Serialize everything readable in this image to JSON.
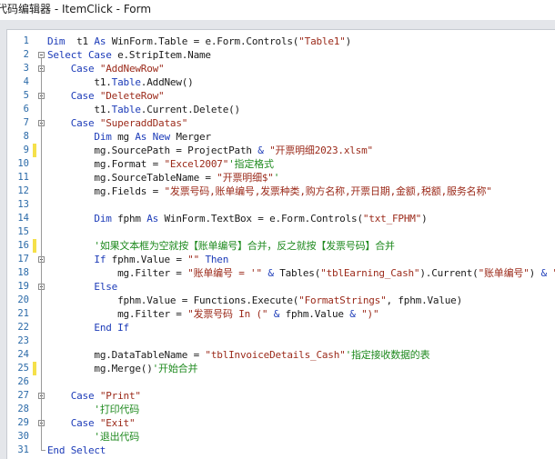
{
  "window": {
    "title": "代码编辑器 - ItemClick - Form"
  },
  "colors": {
    "keyword": "#1c3bb8",
    "string": "#9b2a1a",
    "comment": "#1f8a1f",
    "line_number": "#2b6aa8",
    "change_mark": "#f5e04a"
  },
  "lines": [
    {
      "n": "1",
      "indent": "",
      "parts": [
        [
          "kw",
          "Dim"
        ],
        [
          "",
          "  t1 "
        ],
        [
          "kw",
          "As"
        ],
        [
          "",
          " WinForm.Table = e.Form.Controls("
        ],
        [
          "st",
          "\"Table1\""
        ],
        [
          "",
          ")"
        ]
      ]
    },
    {
      "n": "2",
      "indent": "",
      "parts": [
        [
          "kw",
          "Select Case"
        ],
        [
          "",
          " e.StripItem.Name"
        ]
      ]
    },
    {
      "n": "3",
      "indent": "    ",
      "parts": [
        [
          "kw",
          "Case"
        ],
        [
          " ",
          ""
        ],
        [
          "st",
          " \"AddNewRow\""
        ]
      ]
    },
    {
      "n": "4",
      "indent": "        ",
      "parts": [
        [
          "",
          "t1."
        ],
        [
          "kw",
          "Table"
        ],
        [
          "",
          ".AddNew()"
        ]
      ]
    },
    {
      "n": "5",
      "indent": "    ",
      "parts": [
        [
          "kw",
          "Case"
        ],
        [
          "st",
          " \"DeleteRow\""
        ]
      ]
    },
    {
      "n": "6",
      "indent": "        ",
      "parts": [
        [
          "",
          "t1."
        ],
        [
          "kw",
          "Table"
        ],
        [
          "",
          ".Current.Delete()"
        ]
      ]
    },
    {
      "n": "7",
      "indent": "    ",
      "parts": [
        [
          "kw",
          "Case"
        ],
        [
          "st",
          " \"SuperaddDatas\""
        ]
      ]
    },
    {
      "n": "8",
      "indent": "        ",
      "parts": [
        [
          "kw",
          "Dim"
        ],
        [
          "",
          " mg "
        ],
        [
          "kw",
          "As New"
        ],
        [
          "",
          " Merger"
        ]
      ]
    },
    {
      "n": "9",
      "indent": "        ",
      "parts": [
        [
          "",
          "mg.SourcePath = ProjectPath "
        ],
        [
          "kw",
          "&"
        ],
        [
          "st",
          " \"开票明细2023.xlsm\""
        ]
      ]
    },
    {
      "n": "10",
      "indent": "        ",
      "parts": [
        [
          "",
          "mg.Format = "
        ],
        [
          "st",
          "\"Excel2007\""
        ],
        [
          "cm",
          "'指定格式"
        ]
      ]
    },
    {
      "n": "11",
      "indent": "        ",
      "parts": [
        [
          "",
          "mg.SourceTableName = "
        ],
        [
          "st",
          "\"开票明细$\""
        ],
        [
          "cm",
          "'"
        ]
      ]
    },
    {
      "n": "12",
      "indent": "        ",
      "parts": [
        [
          "",
          "mg.Fields = "
        ],
        [
          "st",
          "\"发票号码,账单编号,发票种类,购方名称,开票日期,金额,税额,服务名称\""
        ]
      ]
    },
    {
      "n": "13",
      "indent": "",
      "parts": []
    },
    {
      "n": "14",
      "indent": "        ",
      "parts": [
        [
          "kw",
          "Dim"
        ],
        [
          "",
          " fphm "
        ],
        [
          "kw",
          "As"
        ],
        [
          "",
          " WinForm.TextBox = e.Form.Controls("
        ],
        [
          "st",
          "\"txt_FPHM\""
        ],
        [
          "",
          ")"
        ]
      ]
    },
    {
      "n": "15",
      "indent": "",
      "parts": []
    },
    {
      "n": "16",
      "indent": "        ",
      "parts": [
        [
          "cm",
          "'如果文本框为空就按【账单编号】合并，反之就按【发票号码】合并"
        ]
      ]
    },
    {
      "n": "17",
      "indent": "        ",
      "parts": [
        [
          "kw",
          "If"
        ],
        [
          "",
          " fphm.Value = "
        ],
        [
          "st",
          "\"\""
        ],
        [
          "kw",
          " Then"
        ]
      ]
    },
    {
      "n": "18",
      "indent": "            ",
      "parts": [
        [
          "",
          "mg.Filter = "
        ],
        [
          "st",
          "\"账单编号 = '\""
        ],
        [
          "kw",
          " &"
        ],
        [
          "",
          " Tables("
        ],
        [
          "st",
          "\"tblEarning_Cash\""
        ],
        [
          "",
          ").Current("
        ],
        [
          "st",
          "\"账单编号\""
        ],
        [
          "",
          ") "
        ],
        [
          "kw",
          "&"
        ],
        [
          "st",
          " \"'\""
        ]
      ]
    },
    {
      "n": "19",
      "indent": "        ",
      "parts": [
        [
          "kw",
          "Else"
        ]
      ]
    },
    {
      "n": "20",
      "indent": "            ",
      "parts": [
        [
          "",
          "fphm.Value = Functions.Execute("
        ],
        [
          "st",
          "\"FormatStrings\""
        ],
        [
          "",
          ", fphm.Value)"
        ]
      ]
    },
    {
      "n": "21",
      "indent": "            ",
      "parts": [
        [
          "",
          "mg.Filter = "
        ],
        [
          "st",
          "\"发票号码 In (\""
        ],
        [
          "kw",
          " &"
        ],
        [
          "",
          " fphm.Value "
        ],
        [
          "kw",
          "&"
        ],
        [
          "st",
          " \")\""
        ]
      ]
    },
    {
      "n": "22",
      "indent": "        ",
      "parts": [
        [
          "kw",
          "End If"
        ]
      ]
    },
    {
      "n": "23",
      "indent": "",
      "parts": []
    },
    {
      "n": "24",
      "indent": "        ",
      "parts": [
        [
          "",
          "mg.DataTableName = "
        ],
        [
          "st",
          "\"tblInvoiceDetails_Cash\""
        ],
        [
          "cm",
          "'指定接收数据的表"
        ]
      ]
    },
    {
      "n": "25",
      "indent": "        ",
      "parts": [
        [
          "",
          "mg.Merge()"
        ],
        [
          "cm",
          "'开始合并"
        ]
      ]
    },
    {
      "n": "26",
      "indent": "",
      "parts": []
    },
    {
      "n": "27",
      "indent": "    ",
      "parts": [
        [
          "kw",
          "Case"
        ],
        [
          "st",
          " \"Print\""
        ]
      ]
    },
    {
      "n": "28",
      "indent": "        ",
      "parts": [
        [
          "cm",
          "'打印代码"
        ]
      ]
    },
    {
      "n": "29",
      "indent": "    ",
      "parts": [
        [
          "kw",
          "Case"
        ],
        [
          "st",
          " \"Exit\""
        ]
      ]
    },
    {
      "n": "30",
      "indent": "        ",
      "parts": [
        [
          "cm",
          "'退出代码"
        ]
      ]
    },
    {
      "n": "31",
      "indent": "",
      "parts": [
        [
          "kw",
          "End Select"
        ]
      ]
    }
  ],
  "modified_lines": [
    "9",
    "16",
    "25"
  ],
  "fold_markers": [
    "2",
    "3",
    "5",
    "7",
    "17",
    "19",
    "27",
    "29"
  ]
}
